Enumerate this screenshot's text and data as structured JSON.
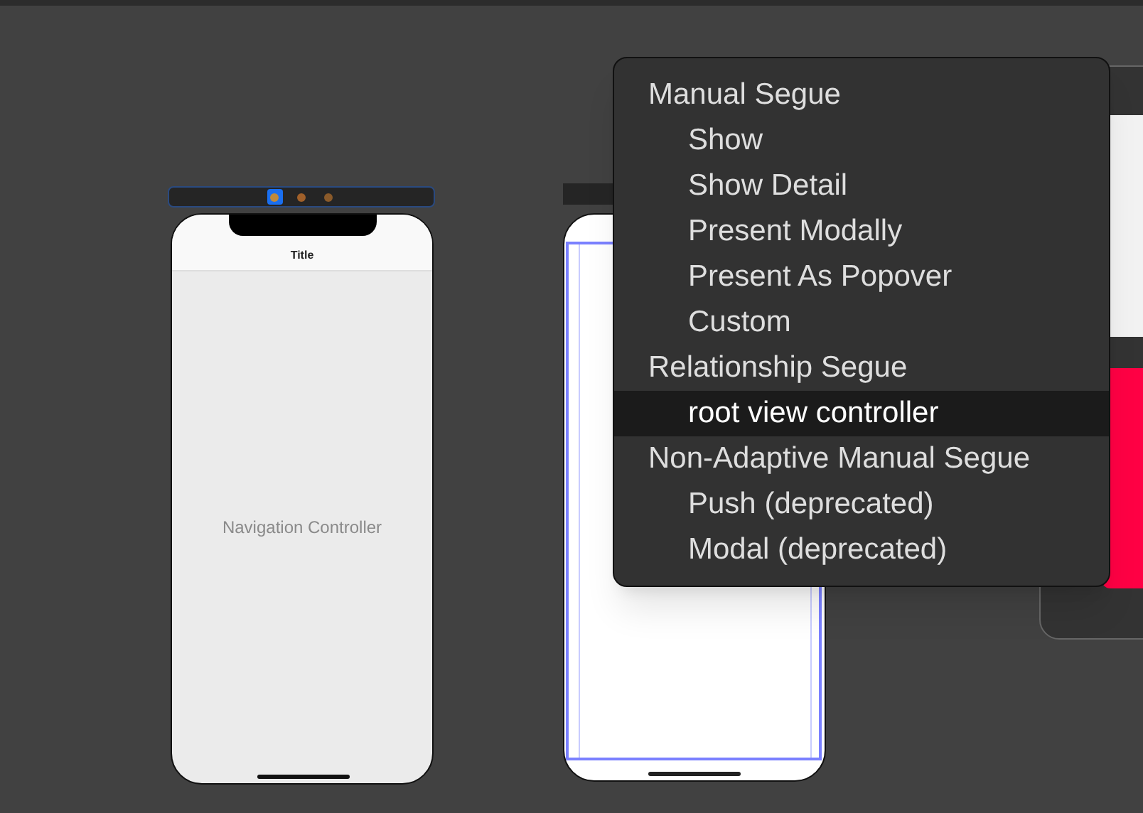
{
  "scenes": [
    {
      "kind": "navigation",
      "title": "Title",
      "label": "Navigation Controller",
      "dock_icons": [
        {
          "selected": true
        },
        {
          "selected": false
        },
        {
          "selected": false
        }
      ]
    },
    {
      "kind": "blank"
    },
    {
      "kind": "partial"
    }
  ],
  "menu": {
    "items": [
      {
        "kind": "header",
        "label": "Manual Segue",
        "selected": false
      },
      {
        "kind": "option",
        "label": "Show",
        "selected": false
      },
      {
        "kind": "option",
        "label": "Show Detail",
        "selected": false
      },
      {
        "kind": "option",
        "label": "Present Modally",
        "selected": false
      },
      {
        "kind": "option",
        "label": "Present As Popover",
        "selected": false
      },
      {
        "kind": "option",
        "label": "Custom",
        "selected": false
      },
      {
        "kind": "header",
        "label": "Relationship Segue",
        "selected": false
      },
      {
        "kind": "option",
        "label": "root view controller",
        "selected": true
      },
      {
        "kind": "header",
        "label": "Non-Adaptive Manual Segue",
        "selected": false
      },
      {
        "kind": "option",
        "label": "Push (deprecated)",
        "selected": false
      },
      {
        "kind": "option",
        "label": "Modal (deprecated)",
        "selected": false
      }
    ]
  }
}
